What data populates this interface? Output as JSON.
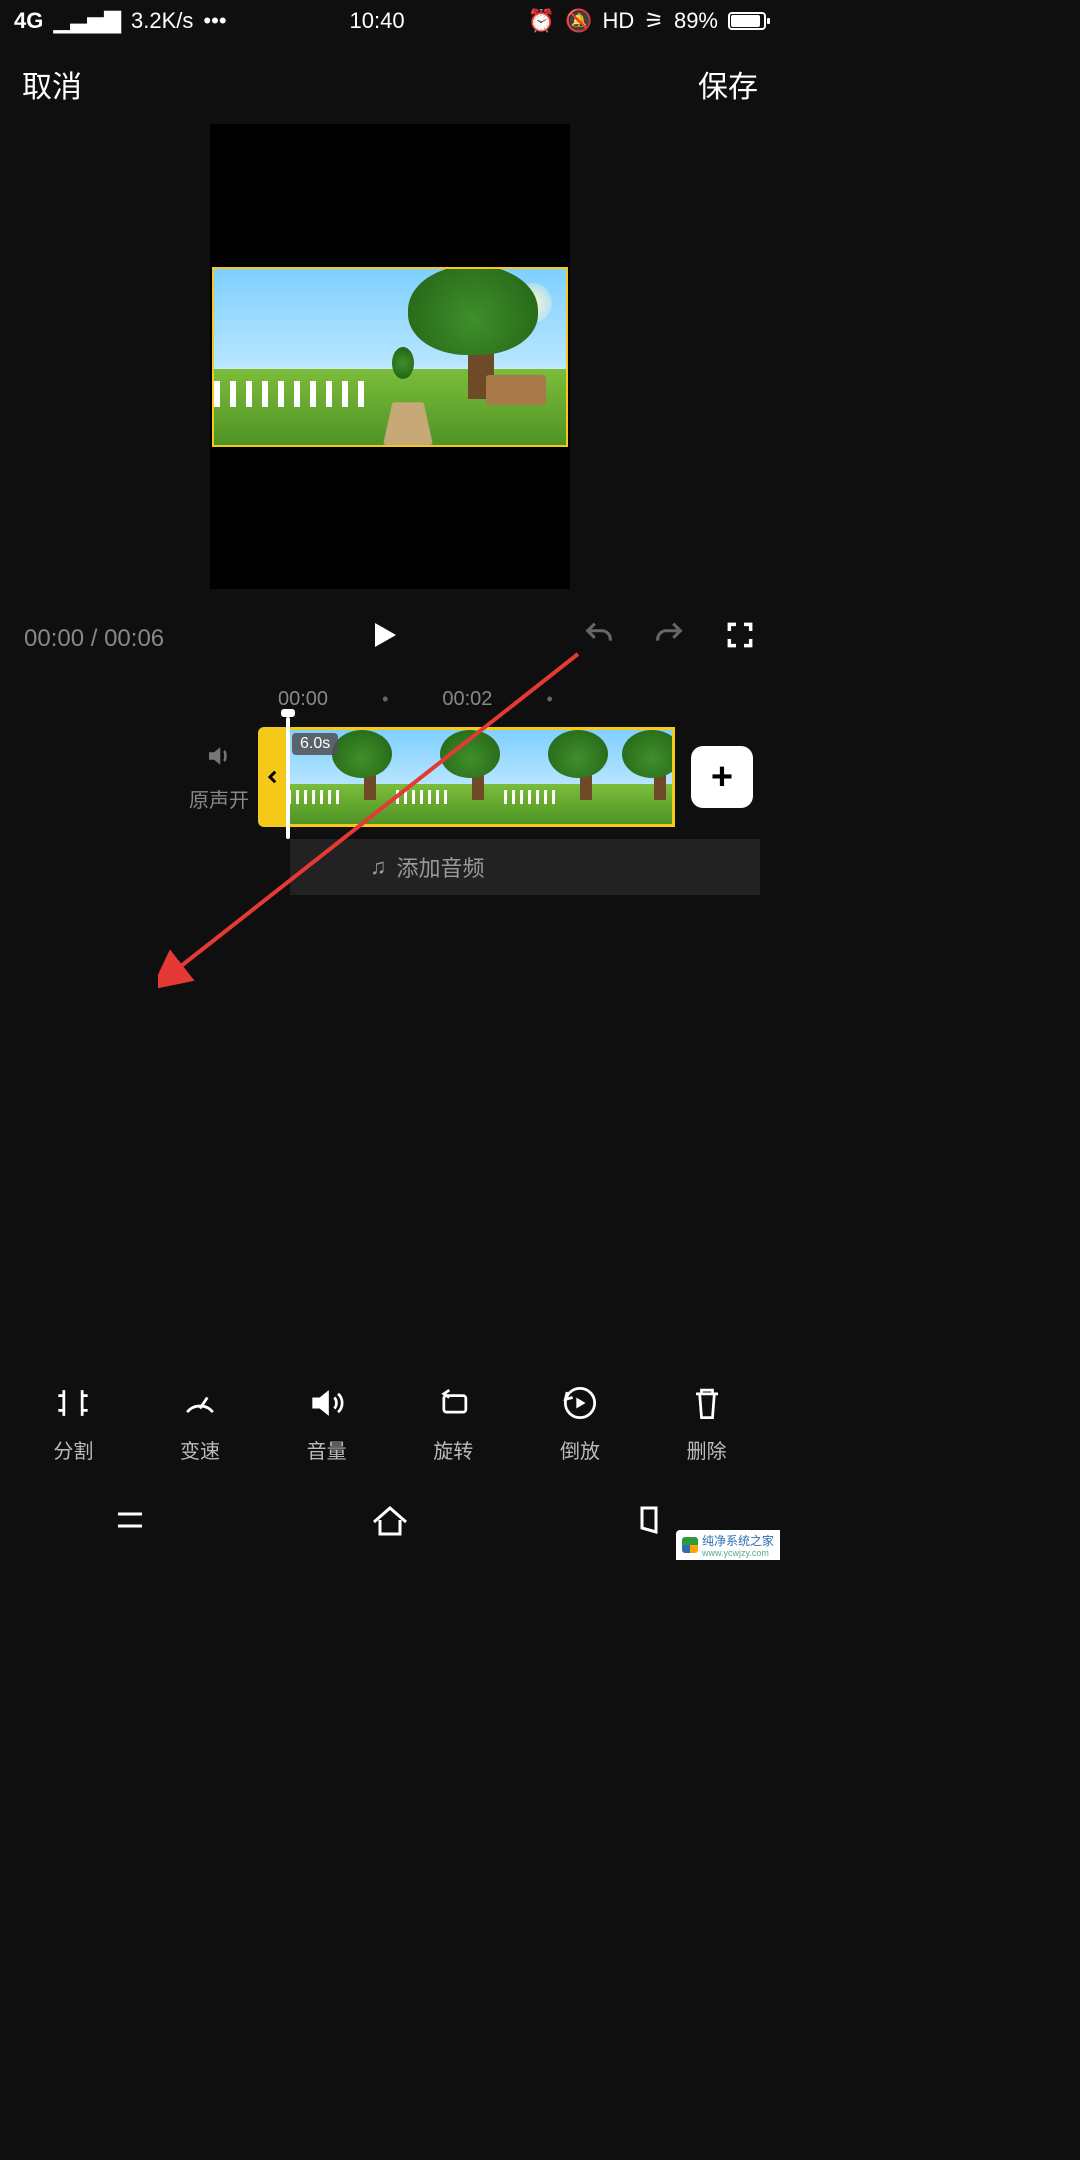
{
  "status": {
    "network": "4G",
    "speed": "3.2K/s",
    "time": "10:40",
    "hd": "HD",
    "battery_pct": "89%"
  },
  "topbar": {
    "cancel": "取消",
    "save": "保存"
  },
  "player": {
    "current_time": "00:00",
    "sep": " / ",
    "total_time": "00:06"
  },
  "ruler": {
    "t0": "00:00",
    "t1": "00:02"
  },
  "sound": {
    "label": "原声开"
  },
  "clip": {
    "duration_badge": "6.0s"
  },
  "audio": {
    "add_label": "添加音频"
  },
  "tools": {
    "split": "分割",
    "speed": "变速",
    "volume": "音量",
    "rotate": "旋转",
    "reverse": "倒放",
    "delete": "删除"
  },
  "watermark": {
    "title": "纯净系统之家",
    "url": "www.ycwjzy.com"
  }
}
